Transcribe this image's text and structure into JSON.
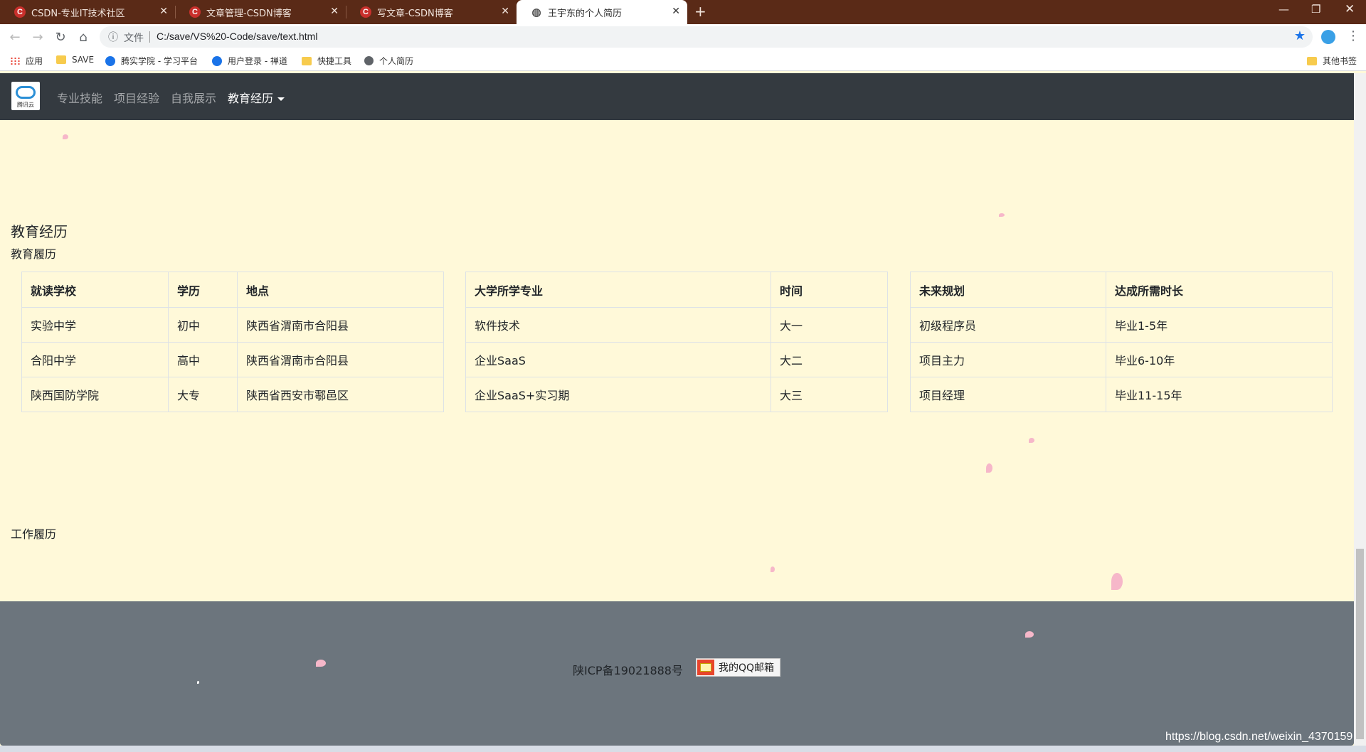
{
  "browser": {
    "tabs": [
      {
        "title": "CSDN-专业IT技术社区",
        "favicon": "csdn-c",
        "active": false
      },
      {
        "title": "文章管理-CSDN博客",
        "favicon": "csdn-c",
        "active": false
      },
      {
        "title": "写文章-CSDN博客",
        "favicon": "csdn-c",
        "active": false
      },
      {
        "title": "王宇东的个人简历",
        "favicon": "globe",
        "active": true
      }
    ],
    "address": {
      "security_label": "文件",
      "url": "C:/save/VS%20-Code/save/text.html"
    },
    "bookmarks": [
      {
        "label": "应用",
        "icon": "apps-grid"
      },
      {
        "label": "SAVE",
        "icon": "folder"
      },
      {
        "label": "腾实学院 - 学习平台",
        "icon": "site"
      },
      {
        "label": "用户登录 - 禅道",
        "icon": "site"
      },
      {
        "label": "快捷工具",
        "icon": "folder"
      },
      {
        "label": "个人简历",
        "icon": "globe"
      }
    ],
    "other_bookmarks": "其他书签"
  },
  "nav": {
    "logo_text": "腾讯云",
    "links": [
      "专业技能",
      "项目经验",
      "自我展示",
      "教育经历"
    ],
    "active_link": "教育经历"
  },
  "main": {
    "section_title": "教育经历",
    "edu_subtitle": "教育履历",
    "work_subtitle": "工作履历",
    "tables": [
      {
        "headers": [
          "就读学校",
          "学历",
          "地点"
        ],
        "rows": [
          [
            "实验中学",
            "初中",
            "陕西省渭南市合阳县"
          ],
          [
            "合阳中学",
            "高中",
            "陕西省渭南市合阳县"
          ],
          [
            "陕西国防学院",
            "大专",
            "陕西省西安市鄠邑区"
          ]
        ]
      },
      {
        "headers": [
          "大学所学专业",
          "时间"
        ],
        "rows": [
          [
            "软件技术",
            "大一"
          ],
          [
            "企业SaaS",
            "大二"
          ],
          [
            "企业SaaS+实习期",
            "大三"
          ]
        ]
      },
      {
        "headers": [
          "未来规划",
          "达成所需时长"
        ],
        "rows": [
          [
            "初级程序员",
            "毕业1-5年"
          ],
          [
            "项目主力",
            "毕业6-10年"
          ],
          [
            "项目经理",
            "毕业11-15年"
          ]
        ]
      }
    ]
  },
  "footer": {
    "icp": "陕ICP备19021888号",
    "qq_mail": "我的QQ邮箱"
  },
  "watermark": "https://blog.csdn.net/weixin_4370159",
  "colors": {
    "page_bg": "#fff9d9",
    "nav_bg": "#343a40",
    "footer_bg": "#6c757d",
    "tab_strip": "#5a2a17",
    "petal": "#f6b7c9"
  }
}
